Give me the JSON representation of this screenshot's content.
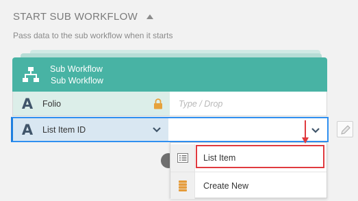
{
  "section": {
    "title": "START SUB WORKFLOW",
    "description": "Pass data to the sub workflow when it starts"
  },
  "card": {
    "title": "Sub Workflow",
    "subtitle": "Sub Workflow",
    "icon": "workflow-hierarchy-icon",
    "header_color": "#48b3a4"
  },
  "fields": [
    {
      "type_icon": "A",
      "label": "Folio",
      "value_placeholder": "Type / Drop",
      "locked": true
    },
    {
      "type_icon": "A",
      "label": "List Item ID",
      "value": "",
      "focused": true
    }
  ],
  "dropdown": {
    "items": [
      {
        "label": "List Item",
        "icon": "list-item-icon",
        "highlighted": true
      },
      {
        "label": "Create New",
        "icon": "create-new-icon"
      }
    ]
  },
  "colors": {
    "focus_border": "#2f8ff0",
    "highlight": "#e0393e",
    "lock": "#e6a23c"
  }
}
